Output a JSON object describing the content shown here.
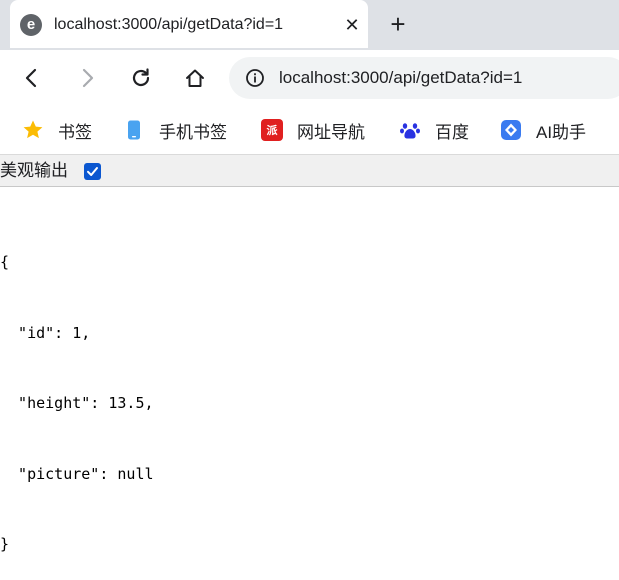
{
  "tab": {
    "favicon": "edge-e-favicon-icon",
    "title": "localhost:3000/api/getData?id=1",
    "close_glyph": "✕",
    "new_tab_glyph": "+"
  },
  "toolbar": {
    "icons": [
      "back-arrow-icon",
      "forward-arrow-icon",
      "reload-icon",
      "home-icon",
      "site-info-icon"
    ],
    "url": "localhost:3000/api/getData?id=1"
  },
  "bookmarks": [
    {
      "label": "书签",
      "icon": "star-icon",
      "color": "#fbbc04"
    },
    {
      "label": "手机书签",
      "icon": "mobile-phone-icon",
      "color": "#4aa3f0"
    },
    {
      "label": "网址导航",
      "icon": "hao123-icon",
      "color": "#e02020"
    },
    {
      "label": "百度",
      "icon": "baidu-paw-icon",
      "color": "#2932e1"
    },
    {
      "label": "AI助手",
      "icon": "ai-assistant-icon",
      "color": "#3a7bf0"
    }
  ],
  "pretty_print": {
    "label": "美观输出",
    "checked": true
  },
  "json_lines": [
    "{",
    "  \"id\": 1,",
    "  \"height\": 13.5,",
    "  \"picture\": null",
    "}"
  ]
}
